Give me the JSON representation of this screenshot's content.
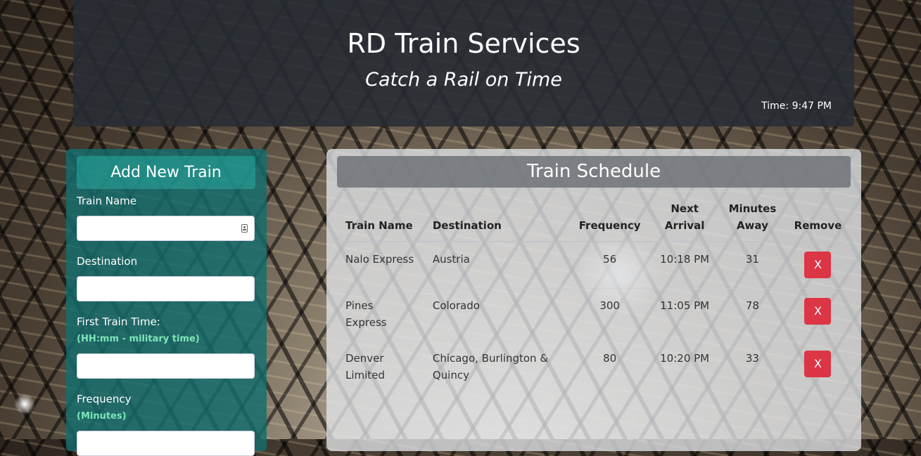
{
  "header": {
    "title": "RD Train Services",
    "subtitle": "Catch a Rail on Time",
    "time": "Time: 9:47 PM"
  },
  "add_train": {
    "title": "Add New Train",
    "train_name_label": "Train Name",
    "destination_label": "Destination",
    "first_time_label": "First Train Time:",
    "first_time_hint": "(HH:mm - military time)",
    "frequency_label": "Frequency",
    "frequency_hint": "(Minutes)"
  },
  "schedule": {
    "title": "Train Schedule",
    "columns": [
      "Train Name",
      "Destination",
      "Frequency",
      "Next Arrival",
      "Minutes Away",
      "Remove"
    ],
    "rows": [
      {
        "name": "Nalo Express",
        "destination": "Austria",
        "frequency": "56",
        "next_arrival": "10:18 PM",
        "minutes_away": "31",
        "remove": "X"
      },
      {
        "name": "Pines Express",
        "destination": "Colorado",
        "frequency": "300",
        "next_arrival": "11:05 PM",
        "minutes_away": "78",
        "remove": "X"
      },
      {
        "name": "Denver Limited",
        "destination": "Chicago, Burlington & Quincy",
        "frequency": "80",
        "next_arrival": "10:20 PM",
        "minutes_away": "33",
        "remove": "X"
      }
    ]
  },
  "colors": {
    "header_bg": "#282c34",
    "panel_bg": "#146e6e",
    "hint": "#7ee6b8",
    "remove_button": "#dc3545"
  }
}
